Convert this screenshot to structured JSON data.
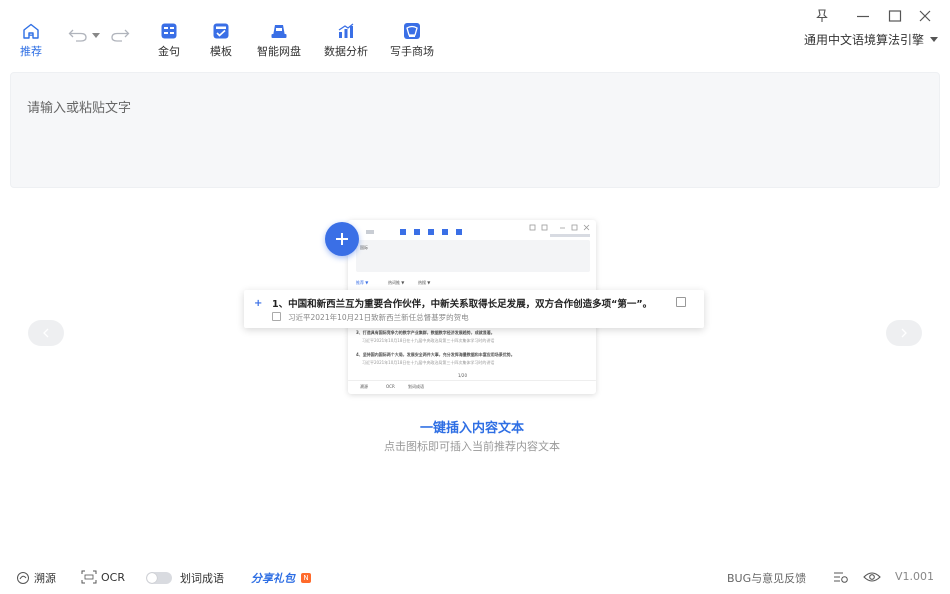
{
  "toolbar": {
    "home_label": "推荐",
    "golden_sentence_label": "金句",
    "template_label": "模板",
    "cloud_disk_label": "智能网盘",
    "data_analysis_label": "数据分析",
    "mall_label": "写手商场",
    "engine_label": "通用中文语境算法引擎"
  },
  "editor": {
    "placeholder": "请输入或粘贴文字"
  },
  "preview": {
    "mini_input_text": "国际",
    "tab1": "推荐 ▼",
    "tab2": "热词推 ▼",
    "tab3": "热搜 ▼",
    "highlight_title": "1、中国和新西兰互为重要合作伙伴，中新关系取得长足发展，双方合作创造多项“第一”。",
    "highlight_source": "习近平2021年10月21日致新西兰新任总督基罗的贺电",
    "item3": "3、打造具有国际竞争力的数字产业集群，数据数字经济发展趋势，成就显著。",
    "item3_source": "习近平2021年10月18日在十九届中央政治局第三十四次集体学习时的讲话",
    "item4": "4、坚持国内国际两个大局，发展安全两件大事，充分发挥海量数据和丰富应用场景优势。",
    "item4_source": "习近平2021年10月18日在十九届中央政治局第三十四次集体学习时的讲话",
    "pager": "1/20",
    "foot1": "溯源",
    "foot2": "OCR",
    "foot3": "划词成语"
  },
  "promo": {
    "title": "一键插入内容文本",
    "subtitle": "点击图标即可插入当前推荐内容文本"
  },
  "footer": {
    "trace_label": "溯源",
    "ocr_label": "OCR",
    "phrase_label": "划词成语",
    "gift_label": "分享礼包",
    "gift_badge": "N",
    "feedback_label": "BUG与意见反馈",
    "version": "V1.001"
  },
  "colors": {
    "accent": "#2f6fe4",
    "badge": "#ff6a2b"
  }
}
